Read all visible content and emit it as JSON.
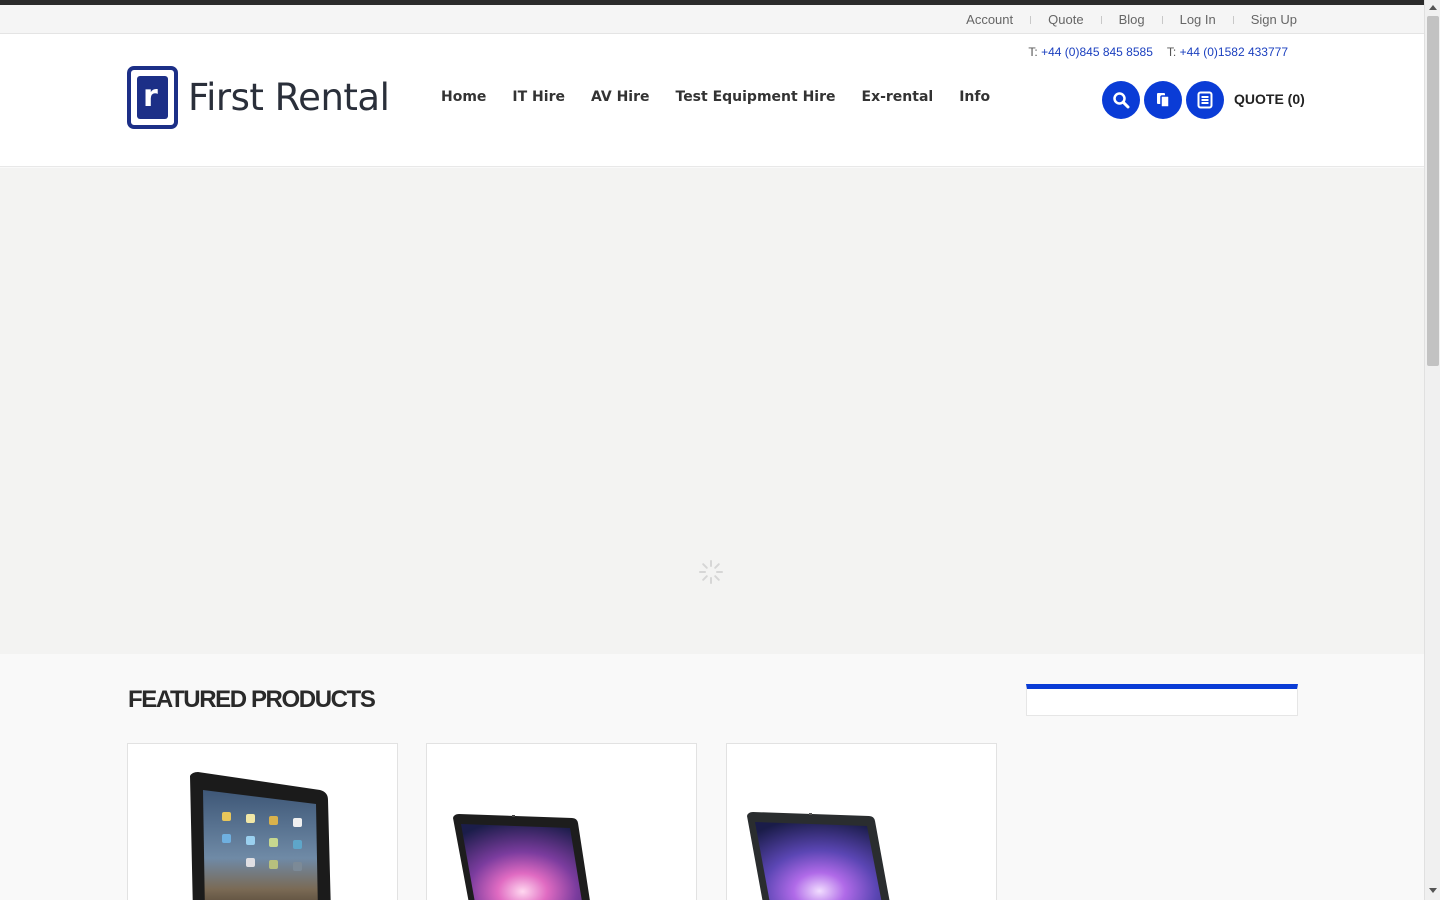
{
  "utility_links": [
    "Account",
    "Quote",
    "Blog",
    "Log In",
    "Sign Up"
  ],
  "phones": [
    {
      "prefix": "T:",
      "number": "+44 (0)845 845 8585"
    },
    {
      "prefix": "T:",
      "number": "+44 (0)1582 433777"
    }
  ],
  "logo": {
    "mark_letter": "r",
    "text": "First Rental"
  },
  "nav": [
    "Home",
    "IT Hire",
    "AV Hire",
    "Test Equipment Hire",
    "Ex-rental",
    "Info"
  ],
  "icon_buttons": [
    {
      "name": "search-icon"
    },
    {
      "name": "copy-icon"
    },
    {
      "name": "list-icon"
    }
  ],
  "quote_label": "QUOTE (0)",
  "featured_title": "FEATURED PRODUCTS",
  "products": [
    {
      "name": "tablet-image"
    },
    {
      "name": "laptop-image"
    },
    {
      "name": "laptop-image"
    }
  ],
  "colors": {
    "accent": "#0a3cd6",
    "brand_navy": "#1c2f87",
    "phone_link": "#1a3fbf"
  }
}
